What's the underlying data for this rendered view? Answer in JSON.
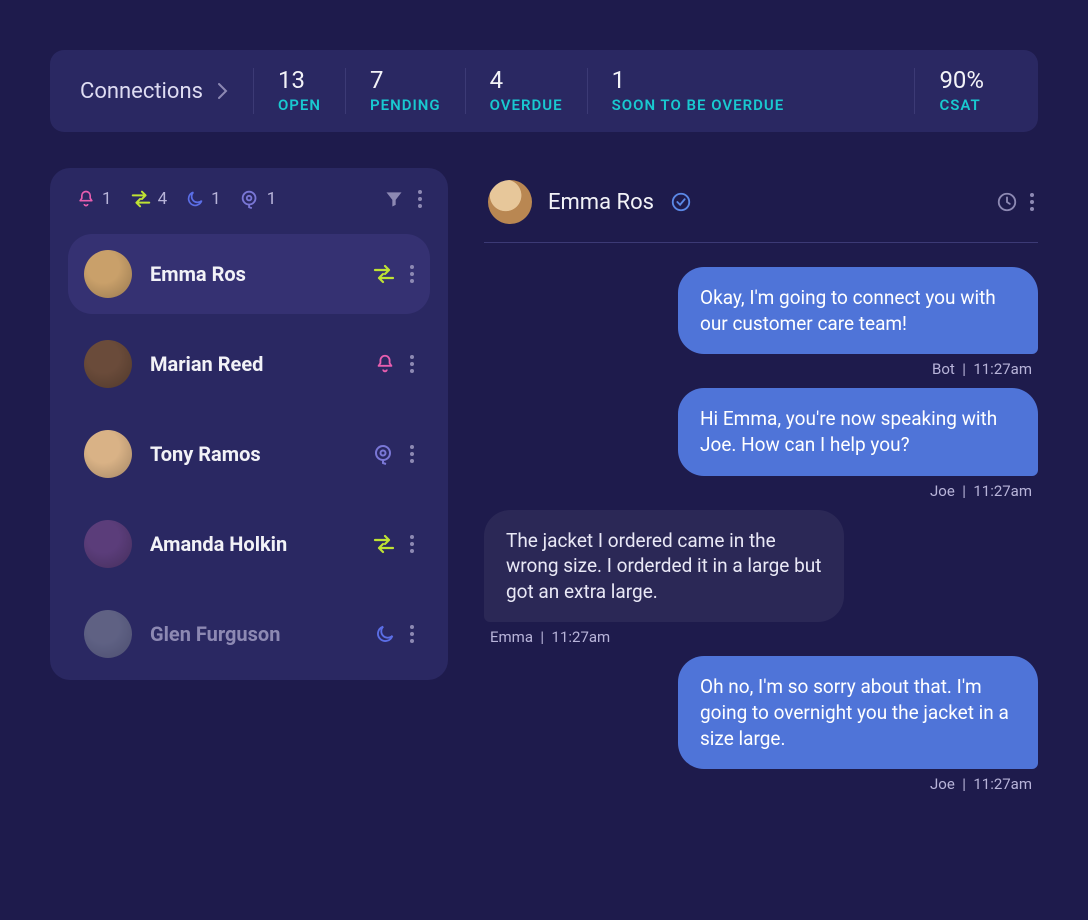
{
  "header": {
    "title": "Connections",
    "stats": [
      {
        "value": "13",
        "label": "OPEN"
      },
      {
        "value": "7",
        "label": "PENDING"
      },
      {
        "value": "4",
        "label": "OVERDUE"
      },
      {
        "value": "1",
        "label": "SOON TO BE OVERDUE"
      }
    ],
    "csat": {
      "value": "90%",
      "label": "CSAT"
    }
  },
  "filters": {
    "bell": "1",
    "transfer": "4",
    "moon": "1",
    "brain": "1"
  },
  "contacts": [
    {
      "name": "Emma Ros",
      "status": "transfer",
      "selected": true
    },
    {
      "name": "Marian Reed",
      "status": "bell"
    },
    {
      "name": "Tony Ramos",
      "status": "brain"
    },
    {
      "name": "Amanda Holkin",
      "status": "transfer"
    },
    {
      "name": "Glen Furguson",
      "status": "moon",
      "dim": true
    }
  ],
  "chat": {
    "with": "Emma Ros",
    "messages": [
      {
        "side": "right",
        "text": "Okay, I'm going to connect you with our customer care team!",
        "author": "Bot",
        "time": "11:27am"
      },
      {
        "side": "right",
        "text": "Hi Emma, you're now speaking with Joe. How can I help you?",
        "author": "Joe",
        "time": "11:27am"
      },
      {
        "side": "left",
        "text": "The jacket I ordered came in the wrong size. I orderded it in a large but got an extra large.",
        "author": "Emma",
        "time": "11:27am"
      },
      {
        "side": "right",
        "text": "Oh no, I'm so sorry about that. I'm going to overnight you the jacket in a size large.",
        "author": "Joe",
        "time": "11:27am"
      }
    ]
  },
  "avatar_colors": [
    "#c9a06a",
    "#6a4b3a",
    "#d9b286",
    "#5b3d7a",
    "#9fa7ad"
  ]
}
